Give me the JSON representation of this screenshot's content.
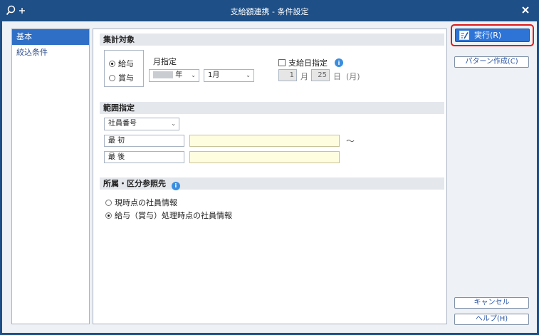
{
  "window": {
    "title": "支給額連携 - 条件設定"
  },
  "icons": {
    "app": "search-plus-icon",
    "close": "close-icon",
    "info": "info-icon",
    "run": "edit-icon"
  },
  "colors": {
    "titlebar": "#1e4f86",
    "accent": "#2e74d6",
    "highlight": "#e01a1a"
  },
  "sidebar": {
    "items": [
      {
        "label": "基本"
      },
      {
        "label": "絞込条件"
      }
    ]
  },
  "target": {
    "heading": "集計対象",
    "options": [
      {
        "label": "給与",
        "selected": true
      },
      {
        "label": "賞与",
        "selected": false
      }
    ],
    "month_label": "月指定",
    "year_suffix": "年",
    "month_select": "1月",
    "payday_label": "支給日指定",
    "payday_checked": false,
    "payday_month": "1",
    "payday_month_unit": "月",
    "payday_day": "25",
    "payday_day_unit": "日",
    "payday_note": "(月)"
  },
  "range": {
    "heading": "範囲指定",
    "field_select": "社員番号",
    "first_label": "最 初",
    "last_label": "最 後",
    "tilde": "～"
  },
  "dept": {
    "heading": "所属・区分参照先",
    "options": [
      {
        "label": "現時点の社員情報",
        "selected": false
      },
      {
        "label": "給与（賞与）処理時点の社員情報",
        "selected": true
      }
    ]
  },
  "buttons": {
    "run": "実行(R)",
    "pattern": "パターン作成(C)",
    "cancel": "キャンセル",
    "help": "ヘルプ(H)"
  }
}
